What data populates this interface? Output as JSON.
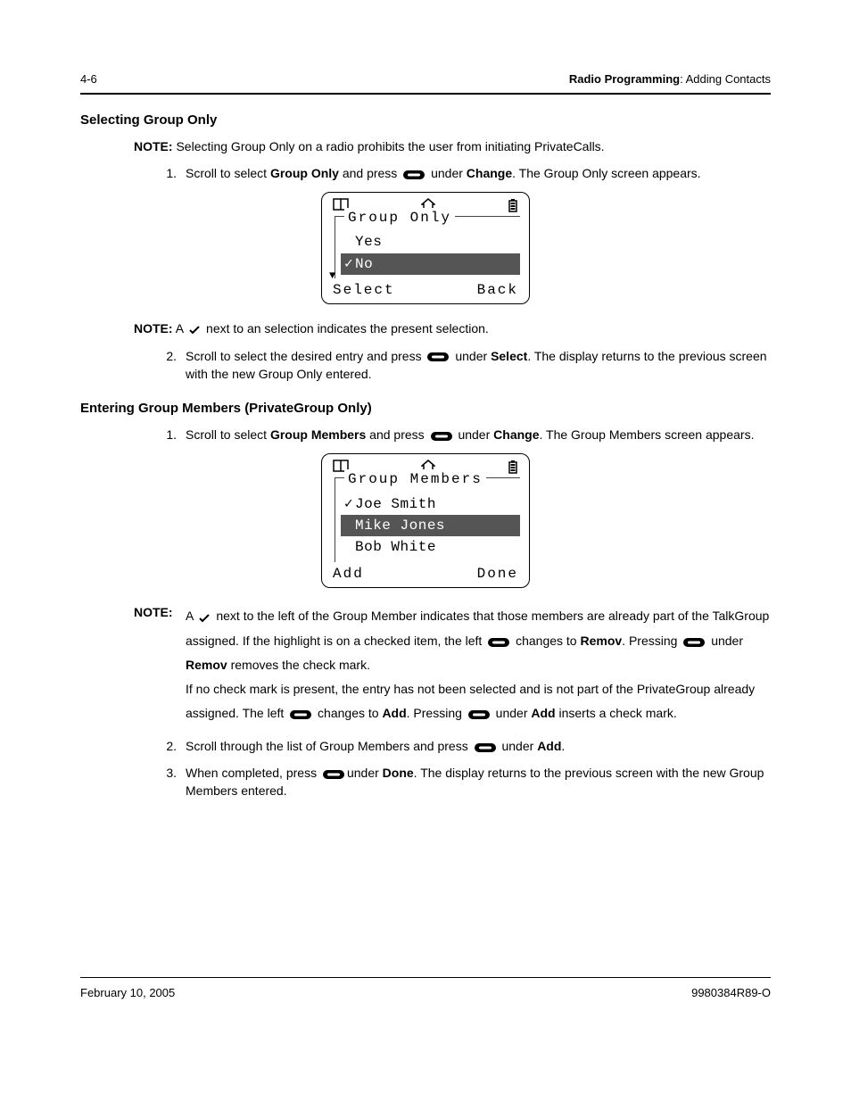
{
  "header": {
    "page_num": "4-6",
    "section_title": "Radio Programming",
    "section_sub": ": Adding Contacts"
  },
  "section1": {
    "heading": "Selecting Group Only",
    "note": "Selecting Group Only on a radio prohibits the user from initiating PrivateCalls.",
    "step1_a": "Scroll to select ",
    "step1_b": "Group Only",
    "step1_c": " and press ",
    "step1_d": " under ",
    "step1_e": "Change",
    "step1_f": ". The Group Only screen appears.",
    "note2_a": "A ",
    "note2_b": " next to an selection indicates the present selection.",
    "step2_a": "Scroll to select the desired entry and press ",
    "step2_b": " under ",
    "step2_c": "Select",
    "step2_d": ". The display returns to the previous screen with the new Group Only entered."
  },
  "lcd1": {
    "title": "Group Only",
    "items": [
      "Yes",
      "No"
    ],
    "selected_index": 1,
    "checked": [
      false,
      true
    ],
    "soft_left": "Select",
    "soft_right": "Back"
  },
  "section2": {
    "heading": "Entering Group Members (PrivateGroup Only)",
    "step1_a": "Scroll to select ",
    "step1_b": "Group Members",
    "step1_c": " and press ",
    "step1_d": " under ",
    "step1_e": "Change",
    "step1_f": ". The Group Members screen appears.",
    "note_a": "A ",
    "note_b": " next to the left of the Group Member indicates that those members are already part of the TalkGroup assigned. If the highlight is on a checked item, the left ",
    "note_c": " changes to ",
    "note_d": "Remov",
    "note_e": ". Pressing ",
    "note_f": " under ",
    "note_g": "Remov",
    "note_h": " removes the check mark.",
    "note_i": "If no check mark is present, the entry has not been selected and is not part of the PrivateGroup already assigned. The left ",
    "note_j": " changes to ",
    "note_k": "Add",
    "note_l": ". Pressing ",
    "note_m": " under ",
    "note_n": "Add",
    "note_o": " inserts a check mark.",
    "step2_a": "Scroll through the list of Group Members and press ",
    "step2_b": " under ",
    "step2_c": "Add",
    "step2_d": ".",
    "step3_a": "When completed, press ",
    "step3_b": "under ",
    "step3_c": "Done",
    "step3_d": ". The display returns to the previous screen with the new Group Members entered."
  },
  "lcd2": {
    "title": "Group Members",
    "items": [
      "Joe Smith",
      "Mike Jones",
      "Bob White"
    ],
    "selected_index": 1,
    "checked": [
      true,
      false,
      false
    ],
    "soft_left": "Add",
    "soft_right": "Done"
  },
  "footer": {
    "date": "February 10, 2005",
    "docnum": "9980384R89-O"
  },
  "labels": {
    "note": "NOTE:",
    "n1": "1.",
    "n2": "2.",
    "n3": "3."
  }
}
